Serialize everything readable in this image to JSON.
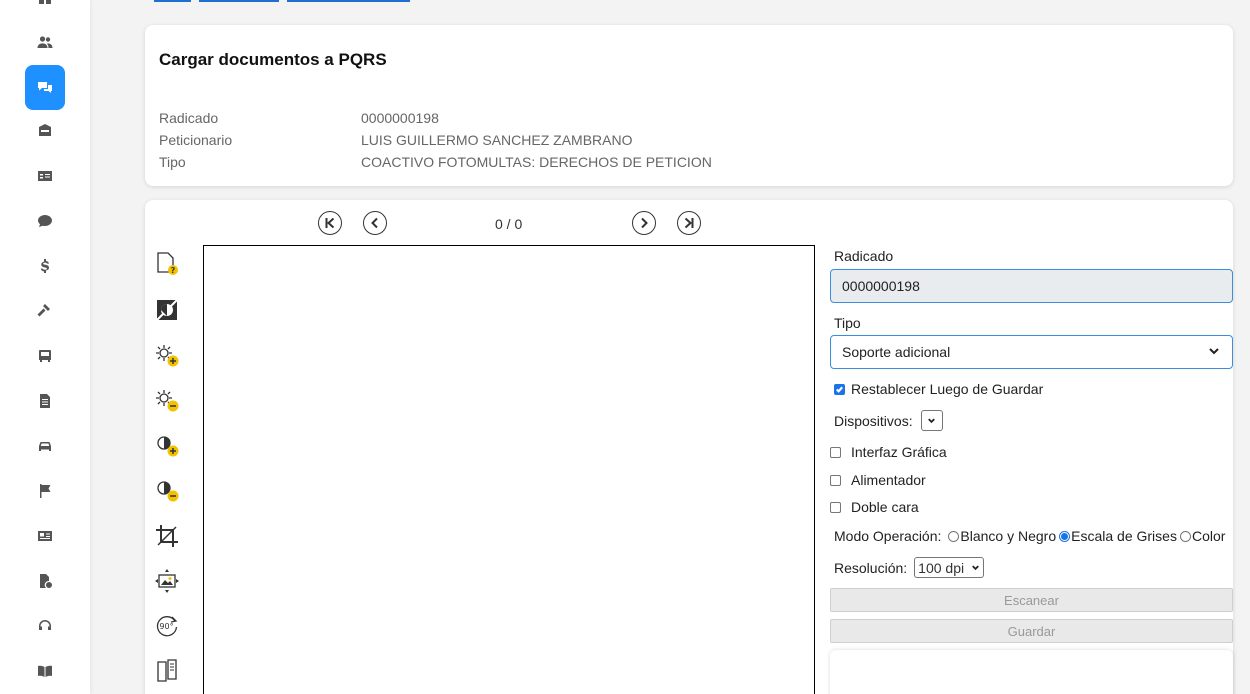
{
  "header": {
    "title": "Cargar documentos a PQRS",
    "info": [
      {
        "label": "Radicado",
        "value": "0000000198"
      },
      {
        "label": "Peticionario",
        "value": "LUIS GUILLERMO SANCHEZ ZAMBRANO"
      },
      {
        "label": "Tipo",
        "value": "COACTIVO FOTOMULTAS: DERECHOS DE PETICION"
      }
    ]
  },
  "sidebar": {
    "icons": [
      "users-icon",
      "chat-icon",
      "inbox-icon",
      "id-card-icon",
      "money-chat-icon",
      "dollar-icon",
      "gavel-icon",
      "bus-icon",
      "document-icon",
      "car-icon",
      "flag-icon",
      "contact-card-icon",
      "file-info-icon",
      "headset-icon",
      "book-icon"
    ],
    "active": "chat-icon"
  },
  "viewer": {
    "page_counter": "0 / 0",
    "tools": [
      "unknown-page-icon",
      "invert-icon",
      "brightness-up-icon",
      "brightness-down-icon",
      "contrast-up-icon",
      "contrast-down-icon",
      "crop-icon",
      "resize-image-icon",
      "rotate-90-icon",
      "split-page-icon"
    ]
  },
  "form": {
    "radicado_label": "Radicado",
    "radicado_value": "0000000198",
    "tipo_label": "Tipo",
    "tipo_value": "Soporte adicional",
    "reset_label": "Restablecer Luego de Guardar",
    "reset_checked": true,
    "devices_label": "Dispositivos:",
    "options": [
      {
        "label": "Interfaz Gráfica",
        "checked": false
      },
      {
        "label": "Alimentador",
        "checked": false
      },
      {
        "label": "Doble cara",
        "checked": false
      }
    ],
    "mode_label": "Modo Operación:",
    "modes": [
      {
        "label": "Blanco y Negro",
        "checked": false
      },
      {
        "label": "Escala de Grises",
        "checked": true
      },
      {
        "label": "Color",
        "checked": false
      }
    ],
    "resolution_label": "Resolución:",
    "resolution_value": "100 dpi",
    "scan_button": "Escanear",
    "save_button": "Guardar"
  },
  "colors": {
    "accent": "#1e90ff",
    "input_border": "#3b8edb",
    "readonly_bg": "#e9ecef"
  }
}
